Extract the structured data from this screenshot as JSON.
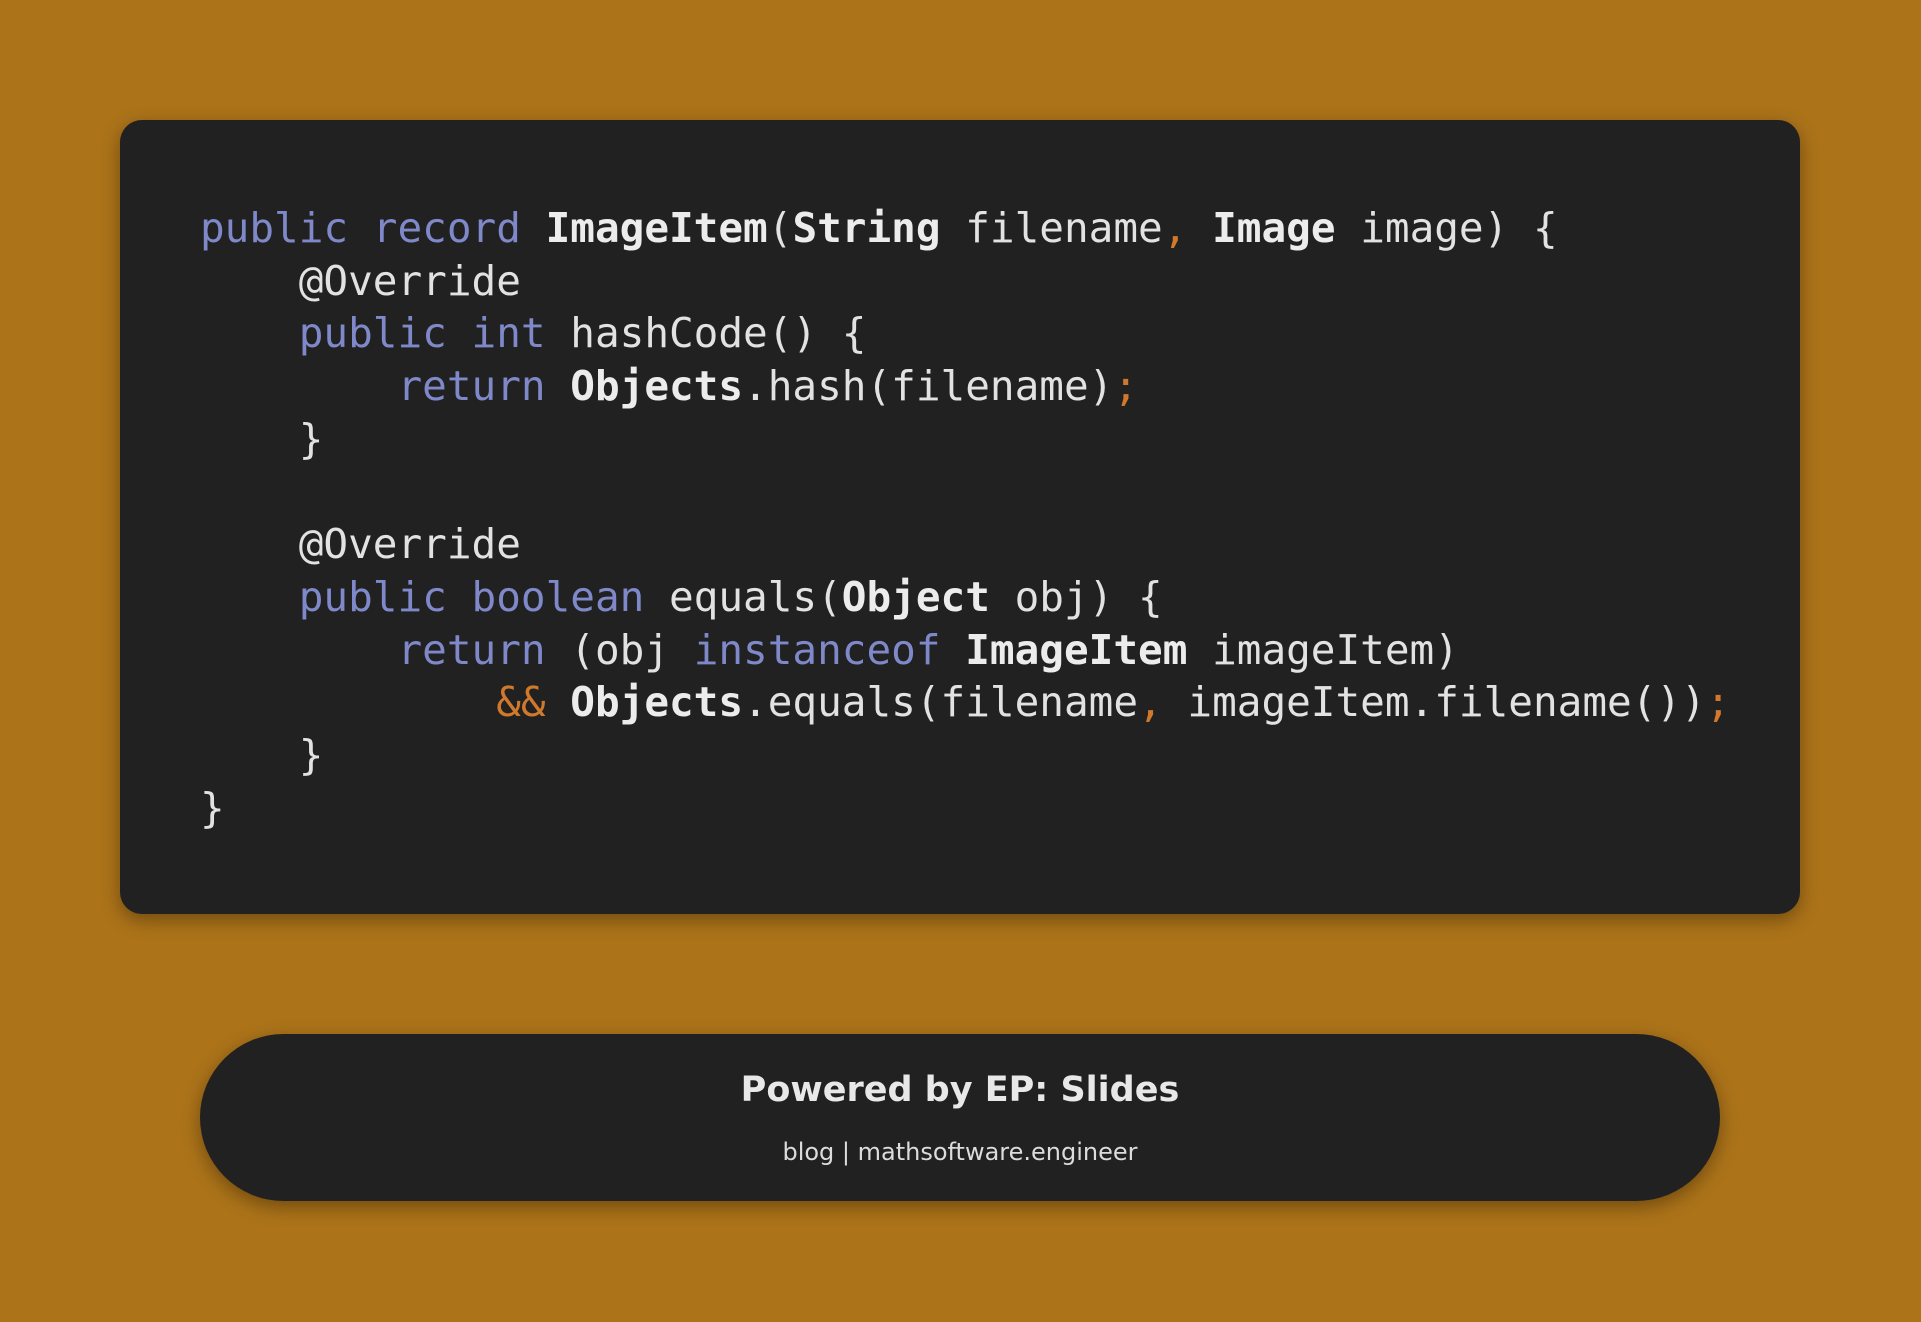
{
  "code": {
    "lines": [
      [
        [
          "kw",
          "public record "
        ],
        [
          "ty",
          "ImageItem"
        ],
        [
          "pl",
          "("
        ],
        [
          "ty",
          "String"
        ],
        [
          "pl",
          " filename"
        ],
        [
          "pu",
          ", "
        ],
        [
          "ty",
          "Image"
        ],
        [
          "pl",
          " image) {"
        ]
      ],
      [
        [
          "pl",
          "    @Override"
        ]
      ],
      [
        [
          "kw",
          "    public int "
        ],
        [
          "pl",
          "hashCode() {"
        ]
      ],
      [
        [
          "kw",
          "        return "
        ],
        [
          "ty",
          "Objects"
        ],
        [
          "pl",
          ".hash(filename)"
        ],
        [
          "pu",
          ";"
        ]
      ],
      [
        [
          "pl",
          "    }"
        ]
      ],
      [
        [
          "pl",
          ""
        ]
      ],
      [
        [
          "pl",
          "    @Override"
        ]
      ],
      [
        [
          "kw",
          "    public boolean "
        ],
        [
          "pl",
          "equals("
        ],
        [
          "ty",
          "Object"
        ],
        [
          "pl",
          " obj) {"
        ]
      ],
      [
        [
          "kw",
          "        return "
        ],
        [
          "pl",
          "(obj "
        ],
        [
          "kw",
          "instanceof "
        ],
        [
          "ty",
          "ImageItem"
        ],
        [
          "pl",
          " imageItem)"
        ]
      ],
      [
        [
          "pu",
          "            && "
        ],
        [
          "ty",
          "Objects"
        ],
        [
          "pl",
          ".equals(filename"
        ],
        [
          "pu",
          ", "
        ],
        [
          "pl",
          "imageItem.filename())"
        ],
        [
          "pu",
          ";"
        ]
      ],
      [
        [
          "pl",
          "    }"
        ]
      ],
      [
        [
          "pl",
          "}"
        ]
      ]
    ]
  },
  "footer": {
    "title": "Powered by EP: Slides",
    "subtitle": "blog | mathsoftware.engineer"
  },
  "colors": {
    "background": "#ac7319",
    "card": "#212121",
    "keyword": "#7f89c9",
    "punctuation": "#d0782c",
    "text": "#e2e2e2"
  }
}
